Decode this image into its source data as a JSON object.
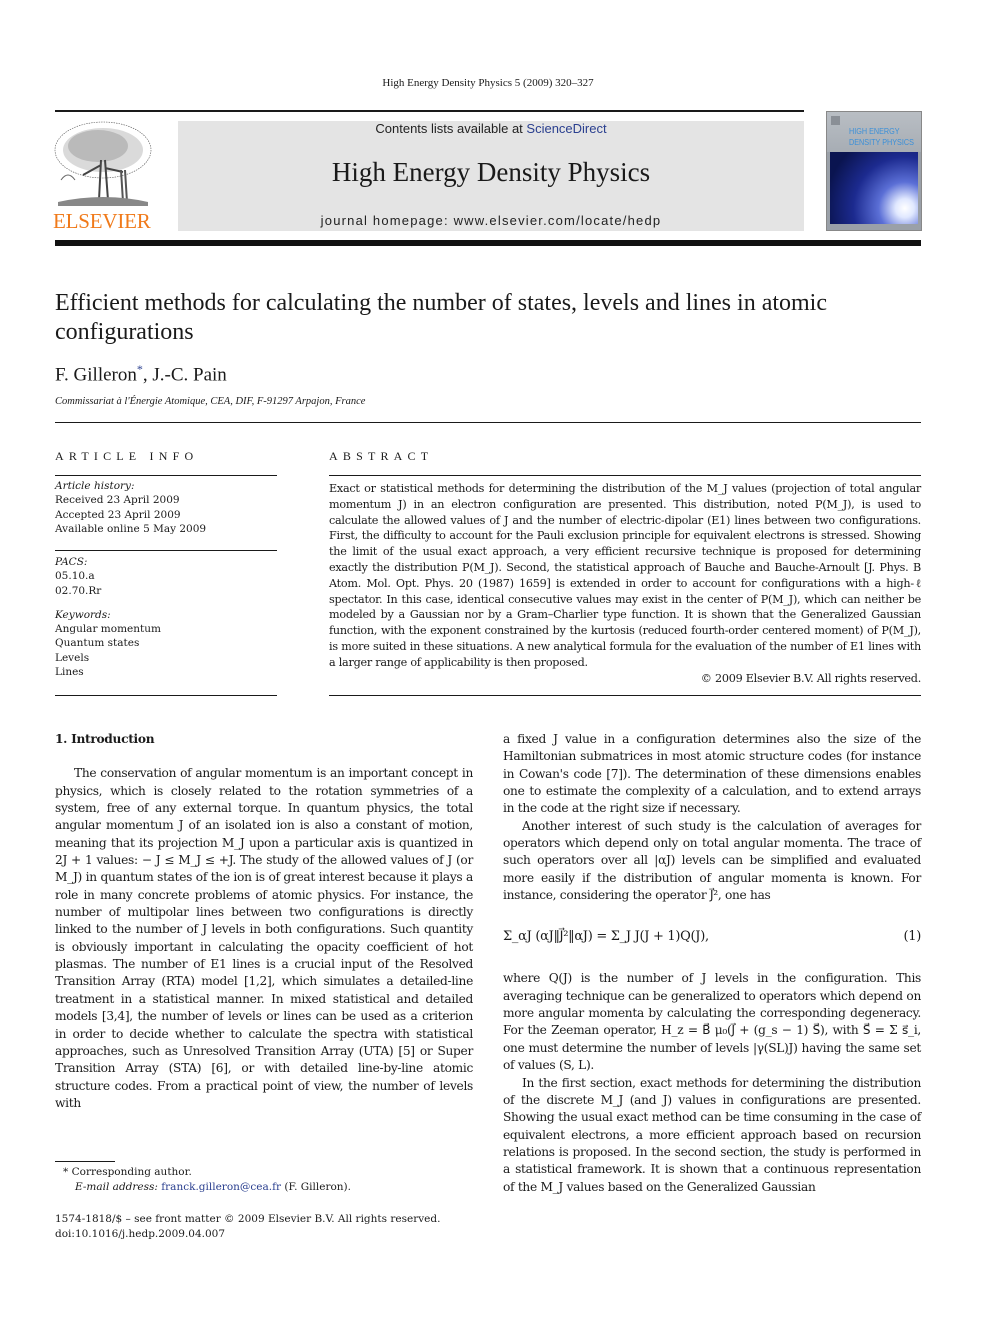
{
  "journal_ref": "High Energy Density Physics 5 (2009) 320–327",
  "header": {
    "publisher_wordmark": "ELSEVIER",
    "contents_prefix": "Contents lists available at ",
    "contents_link": "ScienceDirect",
    "journal_title": "High Energy Density Physics",
    "homepage": "journal homepage: www.elsevier.com/locate/hedp",
    "cover_title_line1": "HIGH ENERGY",
    "cover_title_line2": "DENSITY PHYSICS",
    "colors": {
      "elsevier_orange": "#f07a1a",
      "link_blue": "#2a3f8f",
      "banner_gray": "#e4e4e4"
    }
  },
  "article": {
    "title": "Efficient methods for calculating the number of states, levels and lines in atomic configurations",
    "authors": [
      {
        "name": "F. Gilleron",
        "marker": "*"
      },
      {
        "name": "J.-C. Pain",
        "marker": ""
      }
    ],
    "author_separator": ", ",
    "affiliation": "Commissariat à l'Énergie Atomique, CEA, DIF, F-91297 Arpajon, France"
  },
  "article_info": {
    "heading": "ARTICLE INFO",
    "history_label": "Article history:",
    "history": [
      "Received 23 April 2009",
      "Accepted 23 April 2009",
      "Available online 5 May 2009"
    ],
    "pacs_label": "PACS:",
    "pacs": [
      "05.10.a",
      "02.70.Rr"
    ],
    "keywords_label": "Keywords:",
    "keywords": [
      "Angular momentum",
      "Quantum states",
      "Levels",
      "Lines"
    ]
  },
  "abstract": {
    "heading": "ABSTRACT",
    "text": "Exact or statistical methods for determining the distribution of the M_J values (projection of total angular momentum J) in an electron configuration are presented. This distribution, noted P(M_J), is used to calculate the allowed values of J and the number of electric-dipolar (E1) lines between two configurations. First, the difficulty to account for the Pauli exclusion principle for equivalent electrons is stressed. Showing the limit of the usual exact approach, a very efficient recursive technique is proposed for determining exactly the distribution P(M_J). Second, the statistical approach of Bauche and Bauche-Arnoult [J. Phys. B Atom. Mol. Opt. Phys. 20 (1987) 1659] is extended in order to account for configurations with a high-ℓ spectator. In this case, identical consecutive values may exist in the center of P(M_J), which can neither be modeled by a Gaussian nor by a Gram–Charlier type function. It is shown that the Generalized Gaussian function, with the exponent constrained by the kurtosis (reduced fourth-order centered moment) of P(M_J), is more suited in these situations. A new analytical formula for the evaluation of the number of E1 lines with a larger range of applicability is then proposed.",
    "copyright": "© 2009 Elsevier B.V. All rights reserved."
  },
  "body": {
    "section_title": "1.  Introduction",
    "left_para": "The conservation of angular momentum is an important concept in physics, which is closely related to the rotation symmetries of a system, free of any external torque. In quantum physics, the total angular momentum J of an isolated ion is also a constant of motion, meaning that its projection M_J upon a particular axis is quantized in 2J + 1 values: − J ≤ M_J ≤ +J. The study of the allowed values of J (or M_J) in quantum states of the ion is of great interest because it plays a role in many concrete problems of atomic physics. For instance, the number of multipolar lines between two configurations is directly linked to the number of J levels in both configurations. Such quantity is obviously important in calculating the opacity coefficient of hot plasmas. The number of E1 lines is a crucial input of the Resolved Transition Array (RTA) model [1,2], which simulates a detailed-line treatment in a statistical manner. In mixed statistical and detailed models [3,4], the number of levels or lines can be used as a criterion in order to decide whether to calculate the spectra with statistical approaches, such as Unresolved Transition Array (UTA) [5] or Super Transition Array (STA) [6], or with detailed line-by-line atomic structure codes. From a practical point of view, the number of levels with",
    "right_para1": "a fixed J value in a configuration determines also the size of the Hamiltonian submatrices in most atomic structure codes (for instance in Cowan's code [7]). The determination of these dimensions enables one to estimate the complexity of a calculation, and to extend arrays in the code at the right size if necessary.",
    "right_para2": "Another interest of such study is the calculation of averages for operators which depend only on total angular momenta. The trace of such operators over all |αJ) levels can be simplified and evaluated more easily if the distribution of angular momenta is known. For instance, considering the operator J⃗², one has",
    "equation": "Σ_αJ (αJ‖J⃗²‖αJ) = Σ_J J(J + 1)Q(J),",
    "equation_number": "(1)",
    "right_para3": "where Q(J) is the number of J levels in the configuration. This averaging technique can be generalized to operators which depend on more angular momenta by calculating the corresponding degeneracy. For the Zeeman operator, H_z = B⃗ μ₀(J⃗ + (g_s − 1) S⃗), with S⃗ = Σ s⃗_i, one must determine the number of levels |γ(SL)J) having the same set of values (S, L).",
    "right_para4": "In the first section, exact methods for determining the distribution of the discrete M_J (and J) values in configurations are presented. Showing the usual exact method can be time consuming in the case of equivalent electrons, a more efficient approach based on recursion relations is proposed. In the second section, the study is performed in a statistical framework. It is shown that a continuous representation of the M_J values based on the Generalized Gaussian"
  },
  "footnote": {
    "marker": "*",
    "text": "Corresponding author.",
    "email_label": "E-mail address:",
    "email": "franck.gilleron@cea.fr",
    "email_suffix": " (F. Gilleron)."
  },
  "front_matter": {
    "issn_line": "1574-1818/$ – see front matter © 2009 Elsevier B.V. All rights reserved.",
    "doi": "doi:10.1016/j.hedp.2009.04.007"
  }
}
